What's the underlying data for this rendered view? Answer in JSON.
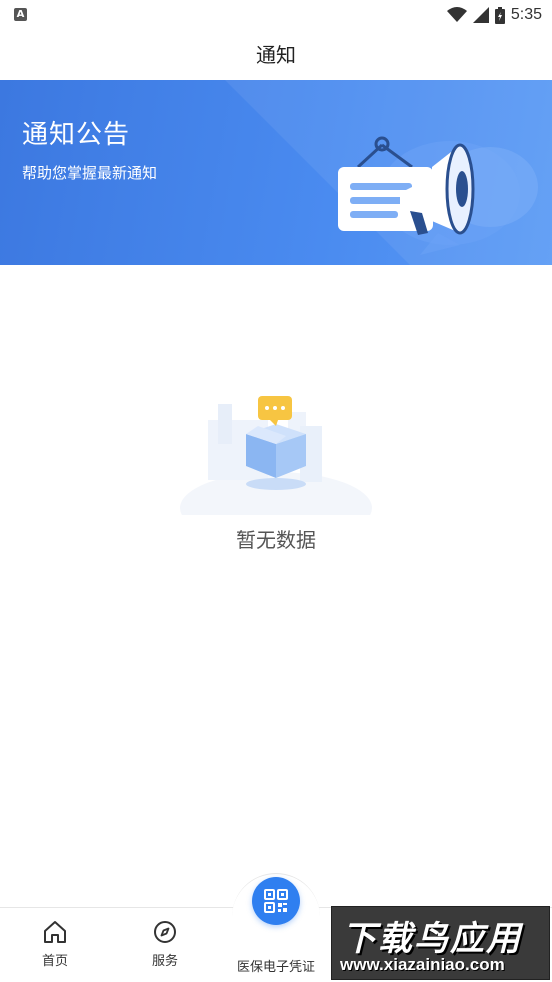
{
  "status_bar": {
    "left_icon_letter": "A",
    "time": "5:35",
    "icons": [
      "wifi-icon",
      "signal-icon",
      "battery-icon"
    ]
  },
  "header": {
    "title": "通知"
  },
  "banner": {
    "title": "通知公告",
    "subtitle": "帮助您掌握最新通知",
    "illustration": "megaphone-notice-illustration",
    "color": "#4a8bf0"
  },
  "empty_state": {
    "illustration": "empty-box-illustration",
    "message": "暂无数据"
  },
  "bottom_nav": {
    "items": [
      {
        "label": "首页",
        "icon": "home-icon"
      },
      {
        "label": "服务",
        "icon": "compass-icon"
      },
      {
        "label": "医保电子凭证",
        "icon": "qr-code-icon"
      }
    ],
    "accent": "#2f7ff0"
  },
  "watermark": {
    "title": "下载鸟应用",
    "url": "www.xiazainiao.com"
  }
}
